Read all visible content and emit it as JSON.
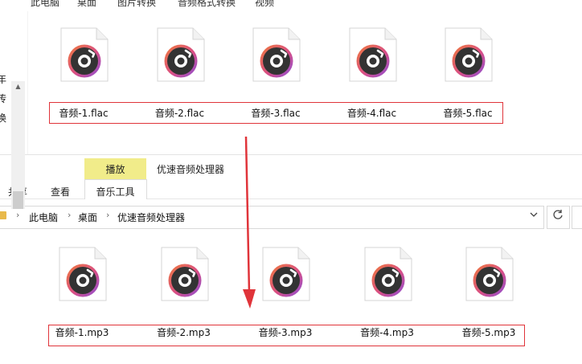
{
  "top_window": {
    "breadcrumb": [
      "此电脑",
      "桌面",
      "图片转换",
      "音频格式转换",
      "视频"
    ],
    "nav_partial_chars": [
      "年",
      "传",
      "换"
    ],
    "files": [
      "音频-1.flac",
      "音频-2.flac",
      "音频-3.flac",
      "音频-4.flac",
      "音频-5.flac"
    ]
  },
  "bottom_window": {
    "ribbon": {
      "context_label": "播放",
      "window_title": "优速音频处理器",
      "tabs": [
        "共享",
        "查看",
        "音乐工具"
      ]
    },
    "addressbar": {
      "breadcrumb": [
        "此电脑",
        "桌面",
        "优速音频处理器"
      ],
      "dropdown_icon": "chevron-down-icon",
      "refresh_icon": "refresh-icon"
    },
    "files": [
      "音频-1.mp3",
      "音频-2.mp3",
      "音频-3.mp3",
      "音频-4.mp3",
      "音频-5.mp3"
    ]
  },
  "annotation": {
    "highlight_color": "#e0343a",
    "arrow_icon": "down-arrow-icon"
  },
  "colors": {
    "context_band": "#f1ec8a",
    "disc_ring_orange": "#f07a3a",
    "disc_ring_purple": "#8a4fd8",
    "disc_dark": "#333333"
  }
}
